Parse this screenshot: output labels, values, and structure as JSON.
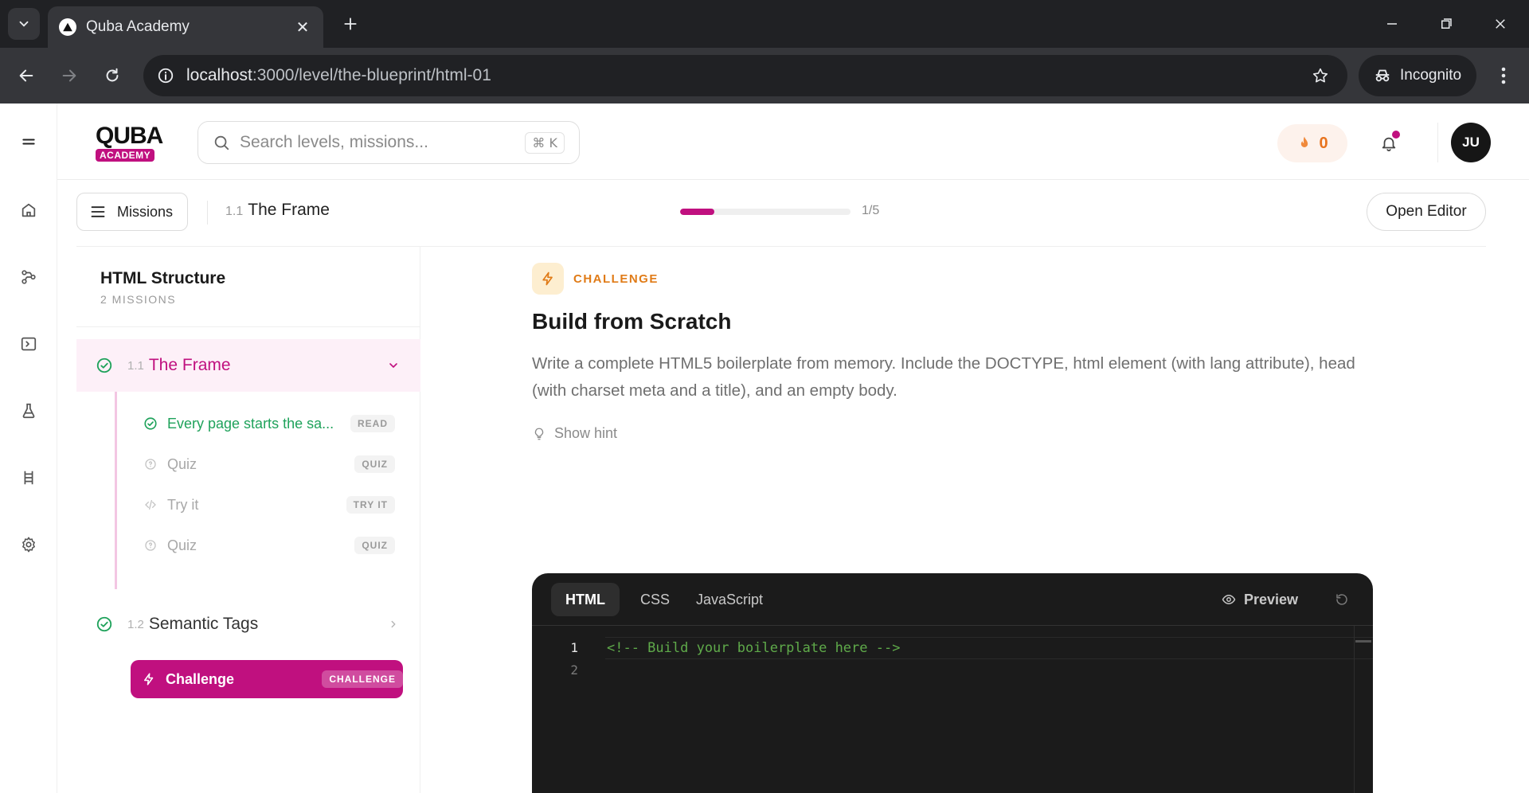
{
  "browser": {
    "tab_title": "Quba Academy",
    "url_host": "localhost",
    "url_rest": ":3000/level/the-blueprint/html-01",
    "incognito_label": "Incognito"
  },
  "header": {
    "logo_top": "QUBA",
    "logo_bottom": "ACADEMY",
    "search_placeholder": "Search levels, missions...",
    "search_shortcut": "⌘ K",
    "streak_count": "0",
    "avatar_initials": "JU"
  },
  "subbar": {
    "missions_label": "Missions",
    "crumb_number": "1.1",
    "crumb_title": "The Frame",
    "progress_label": "1/5",
    "progress_fraction": 0.2,
    "open_editor_label": "Open Editor"
  },
  "mission_panel": {
    "title": "HTML Structure",
    "subtitle": "2 MISSIONS",
    "sections": [
      {
        "number": "1.1",
        "name": "The Frame",
        "items": [
          {
            "label": "Every page starts the sa...",
            "badge": "READ",
            "status": "done",
            "icon": "check-circle-icon"
          },
          {
            "label": "Quiz",
            "badge": "QUIZ",
            "status": "locked",
            "icon": "quiz-icon"
          },
          {
            "label": "Try it",
            "badge": "TRY IT",
            "status": "locked",
            "icon": "code-icon"
          },
          {
            "label": "Quiz",
            "badge": "QUIZ",
            "status": "locked",
            "icon": "quiz-icon"
          },
          {
            "label": "Challenge",
            "badge": "CHALLENGE",
            "status": "current",
            "icon": "bolt-icon"
          }
        ]
      },
      {
        "number": "1.2",
        "name": "Semantic Tags"
      }
    ]
  },
  "challenge": {
    "chip": "CHALLENGE",
    "title": "Build from Scratch",
    "description": "Write a complete HTML5 boilerplate from memory. Include the DOCTYPE, html element (with lang attribute), head (with charset meta and a title), and an empty body.",
    "hint_label": "Show hint"
  },
  "editor": {
    "tabs": [
      "HTML",
      "CSS",
      "JavaScript"
    ],
    "active_tab": "HTML",
    "preview_label": "Preview",
    "line_numbers": [
      "1",
      "2"
    ],
    "code_line_1": "<!-- Build your boilerplate here -->"
  },
  "colors": {
    "brand": "#c0107f",
    "success": "#1fa25b",
    "challenge": "#e07b17"
  }
}
